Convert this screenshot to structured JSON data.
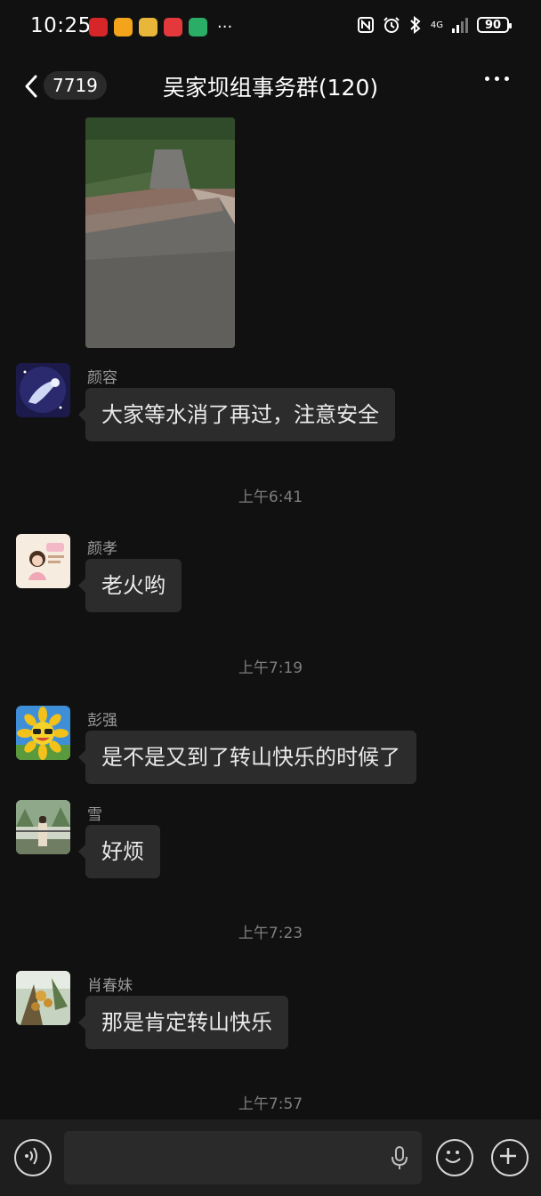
{
  "status_bar": {
    "time": "10:25",
    "battery": "90",
    "network": "4G",
    "more": "···"
  },
  "nav": {
    "back_count": "7719",
    "title": "吴家坝组事务群(120)"
  },
  "messages": [
    {
      "sender": "颜容",
      "text": "大家等水消了再过，注意安全"
    },
    {
      "sender": "颜孝",
      "text": "老火哟"
    },
    {
      "sender": "彭强",
      "text": "是不是又到了转山快乐的时候了"
    },
    {
      "sender": "雪",
      "text": "好烦"
    },
    {
      "sender": "肖春妹",
      "text": "那是肯定转山快乐"
    }
  ],
  "timestamps": [
    "上午6:41",
    "上午7:19",
    "上午7:23",
    "上午7:57"
  ],
  "icons": {
    "back": "chevron-left-icon",
    "menu": "more-horizontal-icon",
    "voice": "voice-input-icon",
    "mic": "microphone-icon",
    "emoji": "emoji-icon",
    "plus": "plus-icon"
  },
  "colors": {
    "background": "#111111",
    "bubble": "#2c2c2c",
    "input_bar": "#1e1e1e"
  }
}
